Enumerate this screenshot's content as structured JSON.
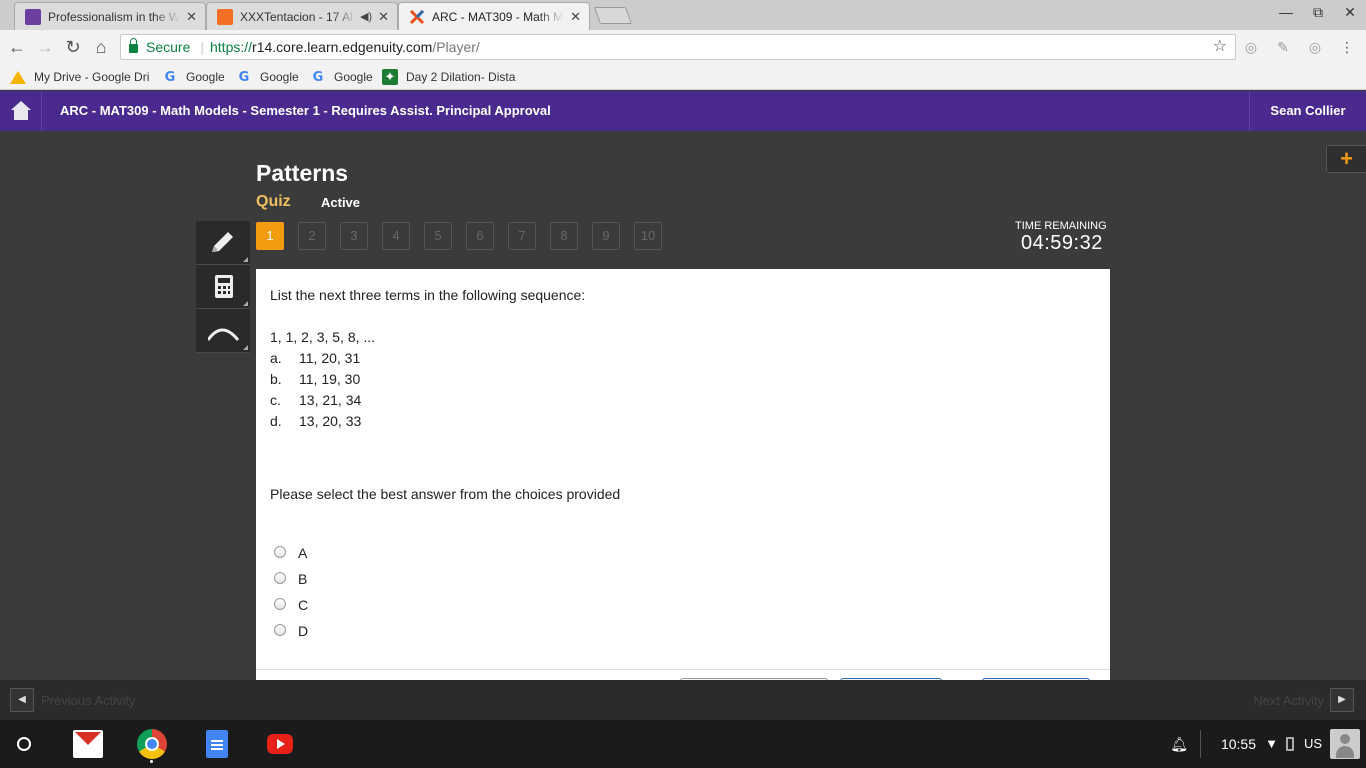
{
  "browser": {
    "tabs": [
      {
        "title": "Professionalism in the W",
        "icon": "person-icon",
        "color": "#6b3fa0"
      },
      {
        "title": "XXXTentacion - 17 Al",
        "icon": "soundcloud-icon",
        "color": "#f26f23",
        "speaker_icon": "◀)"
      },
      {
        "title": "ARC - MAT309 - Math Mc",
        "icon": "edgenuity-icon",
        "color": "#e94e1b"
      }
    ],
    "url": {
      "secure_label": "Secure",
      "scheme": "https://",
      "host": "r14.core.learn.edgenuity.com",
      "path": "/Player/"
    },
    "bookmarks": [
      {
        "label": "My Drive - Google Dri",
        "icon": "google-drive-icon"
      },
      {
        "label": "Google",
        "icon": "google-icon"
      },
      {
        "label": "Google",
        "icon": "google-icon"
      },
      {
        "label": "Google",
        "icon": "google-icon"
      },
      {
        "label": "Day 2 Dilation- Dista",
        "icon": "classroom-icon"
      }
    ]
  },
  "app": {
    "course_title": "ARC - MAT309 - Math Models - Semester 1 - Requires Assist. Principal Approval",
    "user_name": "Sean Collier",
    "plus_symbol": "+",
    "accent": "#f39c12",
    "header_color": "#4b2a8f"
  },
  "activity": {
    "lesson_title": "Patterns",
    "type": "Quiz",
    "status": "Active",
    "question_numbers": [
      "1",
      "2",
      "3",
      "4",
      "5",
      "6",
      "7",
      "8",
      "9",
      "10"
    ],
    "current_question": "1",
    "timer_label": "TIME REMAINING",
    "timer": "04:59:32",
    "tools": [
      "pencil-icon",
      "calculator-icon",
      "arch-icon"
    ]
  },
  "question": {
    "prompt": "List the next three terms in the following sequence:",
    "sequence": "1, 1, 2, 3, 5, 8, ...",
    "choices": [
      {
        "letter": "a.",
        "text": "11, 20, 31"
      },
      {
        "letter": "b.",
        "text": "11, 19, 30"
      },
      {
        "letter": "c.",
        "text": "13, 21, 34"
      },
      {
        "letter": "d.",
        "text": "13, 20, 33"
      }
    ],
    "instruction": "Please select the best answer from the choices provided",
    "radio_options": [
      "A",
      "B",
      "C",
      "D"
    ]
  },
  "nav": {
    "prev_label": "Previous Activity",
    "next_label": "Next Activity"
  },
  "tray": {
    "time": "10:55",
    "ime": "US"
  }
}
